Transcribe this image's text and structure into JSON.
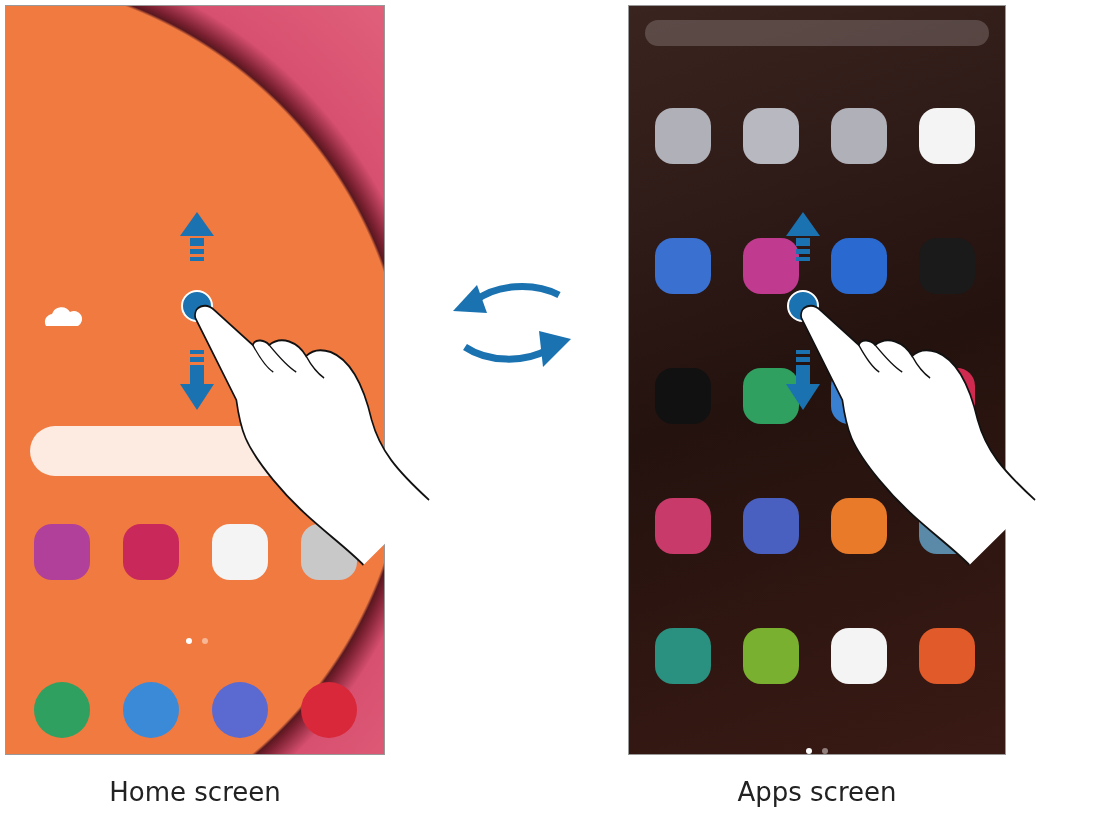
{
  "screens": [
    {
      "kind": "home",
      "caption": "Home screen",
      "apps": [
        {
          "color": "#b0409a"
        },
        {
          "color": "#c8285a"
        },
        {
          "color": "#f4f4f4"
        },
        {
          "color": "#c8c8c8"
        }
      ],
      "page_dots": [
        {
          "selected": true
        },
        {
          "selected": false
        }
      ],
      "dock": [
        {
          "color": "#2fa060"
        },
        {
          "color": "#3a8ad8"
        },
        {
          "color": "#5a6ad0"
        },
        {
          "color": "#d8283a"
        }
      ]
    },
    {
      "kind": "apps",
      "caption": "Apps screen",
      "grid": [
        [
          {
            "color": "#b0b0b8"
          },
          {
            "color": "#b8b8c0"
          },
          {
            "color": "#b0b0b8"
          },
          {
            "color": "#f4f4f4"
          }
        ],
        [
          {
            "color": "#3a70d0"
          },
          {
            "color": "#c03a90"
          },
          {
            "color": "#2a6ad0"
          },
          {
            "color": "#1a1a1a"
          }
        ],
        [
          {
            "color": "#111111"
          },
          {
            "color": "#30a060"
          },
          {
            "color": "#3a80d0"
          },
          {
            "color": "#d02a50"
          }
        ],
        [
          {
            "color": "#c83a6a"
          },
          {
            "color": "#4a60c0"
          },
          {
            "color": "#e87a2a"
          },
          {
            "color": "#5a8aa8"
          }
        ],
        [
          {
            "color": "#2a9080"
          },
          {
            "color": "#7ab030"
          },
          {
            "color": "#f4f4f4"
          },
          {
            "color": "#e05a2a"
          }
        ]
      ],
      "page_dots": [
        {
          "selected": true
        },
        {
          "selected": false
        }
      ]
    }
  ]
}
